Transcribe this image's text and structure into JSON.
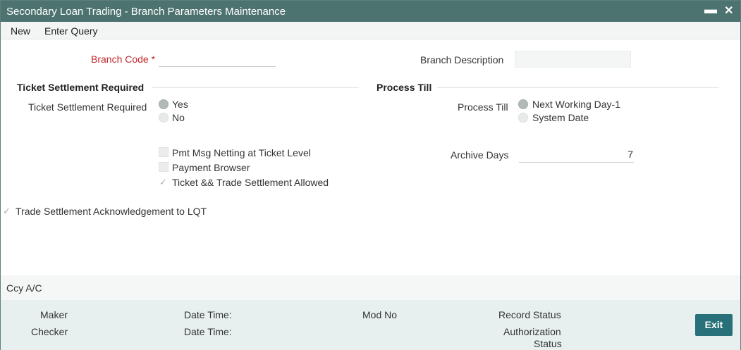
{
  "window": {
    "title": "Secondary Loan Trading - Branch Parameters Maintenance",
    "minimize_glyph": "▬",
    "close_glyph": "✕"
  },
  "menu": {
    "new": "New",
    "enter_query": "Enter Query"
  },
  "branch": {
    "code_label": "Branch Code",
    "required_mark": "*",
    "code_value": "",
    "description_label": "Branch Description",
    "description_value": ""
  },
  "ticket_section": {
    "title": "Ticket Settlement Required",
    "field_label": "Ticket Settlement Required",
    "options": [
      "Yes",
      "No"
    ],
    "selected": "Yes"
  },
  "process_section": {
    "title": "Process Till",
    "field_label": "Process Till",
    "options": [
      "Next Working Day-1",
      "System Date"
    ],
    "selected": "Next Working Day-1"
  },
  "checkboxes": {
    "pmt_msg_netting": {
      "label": "Pmt Msg Netting at Ticket Level",
      "checked": false
    },
    "payment_browser": {
      "label": "Payment Browser",
      "checked": false
    },
    "ticket_trade_settlement": {
      "label": "Ticket && Trade Settlement Allowed",
      "checked": true
    },
    "trade_settlement_ack": {
      "label": "Trade Settlement Acknowledgement to LQT",
      "checked": true
    }
  },
  "archive": {
    "label": "Archive Days",
    "value": "7"
  },
  "ccy_tab": {
    "label": "Ccy A/C"
  },
  "footer": {
    "maker": "Maker",
    "checker": "Checker",
    "date_time_1": "Date Time:",
    "date_time_2": "Date Time:",
    "mod_no": "Mod No",
    "record_status": "Record Status",
    "authorization": "Authorization",
    "status": "Status",
    "exit": "Exit"
  },
  "colors": {
    "titlebar": "#4d7370",
    "required": "#c0272d",
    "footer_bg": "#e8f0ef",
    "exit_button": "#28707a"
  }
}
